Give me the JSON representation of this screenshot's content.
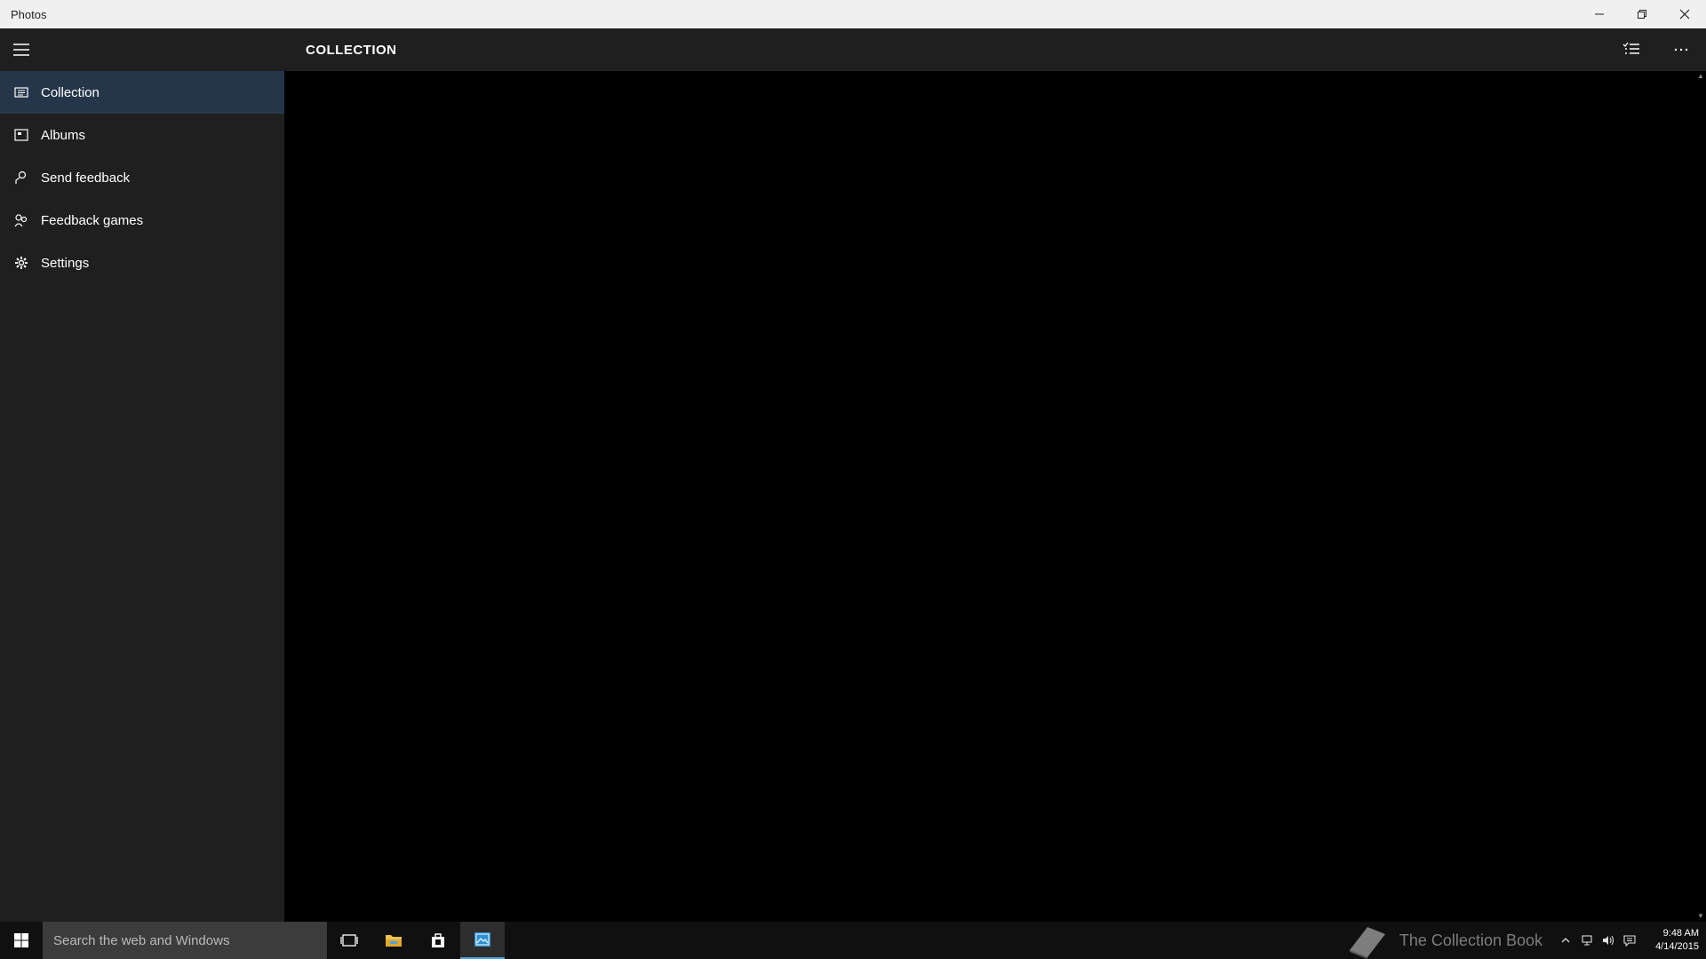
{
  "window": {
    "title": "Photos"
  },
  "sidebar": {
    "items": [
      {
        "label": "Collection",
        "icon": "collection-icon",
        "active": true
      },
      {
        "label": "Albums",
        "icon": "album-icon",
        "active": false
      },
      {
        "label": "Send feedback",
        "icon": "feedback-icon",
        "active": false
      },
      {
        "label": "Feedback games",
        "icon": "feedback-games-icon",
        "active": false
      },
      {
        "label": "Settings",
        "icon": "gear-icon",
        "active": false
      }
    ]
  },
  "header": {
    "title": "COLLECTION"
  },
  "taskbar": {
    "search_placeholder": "Search the web and Windows",
    "watermark": "The Collection Book",
    "time": "9:48 AM",
    "date": "4/14/2015"
  },
  "colors": {
    "sidebar_bg": "#1f1f1f",
    "active_item_bg": "#26364a",
    "content_bg": "#000000",
    "taskbar_bg": "#101010",
    "accent": "#4da3e0"
  }
}
